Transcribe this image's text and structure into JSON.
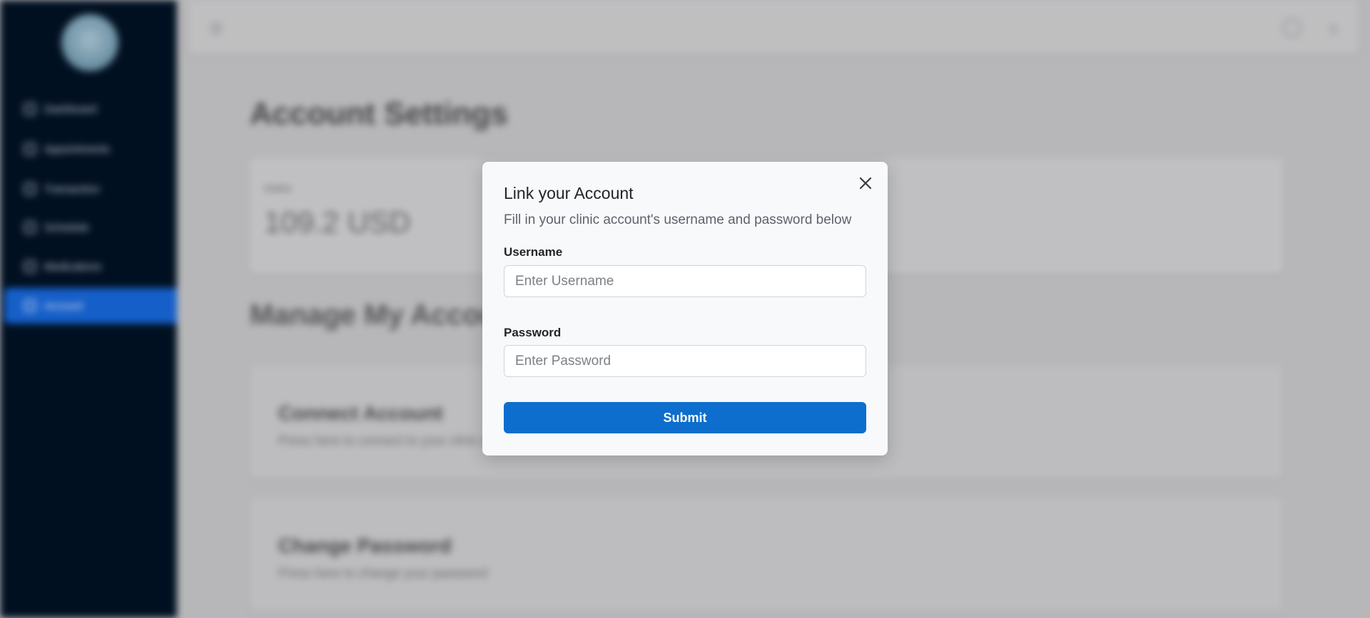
{
  "sidebar": {
    "items": [
      {
        "label": "Dashboard"
      },
      {
        "label": "Appointments"
      },
      {
        "label": "Transaction"
      },
      {
        "label": "Schedule"
      },
      {
        "label": "Medications"
      },
      {
        "label": "Account"
      }
    ]
  },
  "main": {
    "page_title": "Account Settings",
    "balance": {
      "label": "Wallet",
      "value": "109.2 USD"
    },
    "section_title": "Manage My Account",
    "cards": [
      {
        "title": "Connect Account",
        "description": "Press here to connect to your clinic account"
      },
      {
        "title": "Change Password",
        "description": "Press here to change your password"
      }
    ]
  },
  "modal": {
    "title": "Link your Account",
    "subtitle": "Fill in your clinic account's username and password below",
    "username": {
      "label": "Username",
      "placeholder": "Enter Username",
      "value": ""
    },
    "password": {
      "label": "Password",
      "placeholder": "Enter Password",
      "value": ""
    },
    "submit_label": "Submit"
  },
  "colors": {
    "sidebar_bg": "#021224",
    "accent": "#0d6ecd",
    "active_nav": "#1765d6"
  },
  "icons": {
    "close": "close-icon",
    "menu": "menu-icon",
    "user": "user-icon",
    "logout": "logout-icon"
  }
}
